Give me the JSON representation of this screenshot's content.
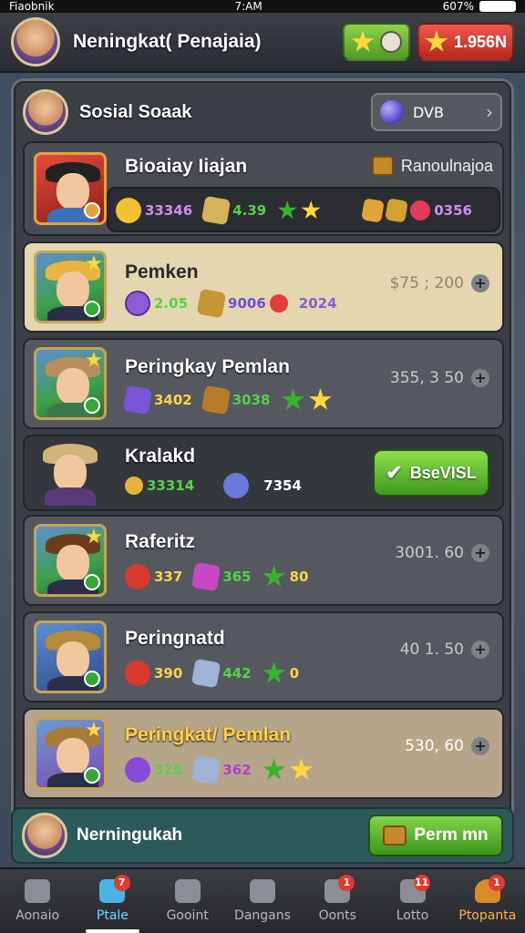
{
  "status": {
    "carrier": "Fiaobnik",
    "time": "7:AM",
    "battery": "607%"
  },
  "header": {
    "title": "Neningkat( Penajaia)",
    "gold_value": "1.956N"
  },
  "panel": {
    "title": "Sosial Soaak",
    "server_value": "DVB"
  },
  "featured": {
    "name": "Bioaiay Iiajan",
    "rank_label": "Ranoulnajoa",
    "res1": "33346",
    "res2": "4.39",
    "res3": "0356"
  },
  "rows": [
    {
      "name": "Pemken",
      "power": "$75 ; 200",
      "r1": "2.05",
      "r2": "9006",
      "r3": "2024"
    },
    {
      "name": "Peringkay Pemlan",
      "power": "355, 3 50",
      "r1": "3402",
      "r2": "3038",
      "r3": ""
    },
    {
      "name": "Kralakd",
      "power": "",
      "r1": "33314",
      "r2": "7354",
      "r3": "",
      "button": "BseVISL"
    },
    {
      "name": "Raferitz",
      "power": "3001. 60",
      "r1": "337",
      "r2": "365",
      "r3": "80"
    },
    {
      "name": "Peringnatd",
      "power": "40 1. 50",
      "r1": "390",
      "r2": "442",
      "r3": "0"
    },
    {
      "name": "Peringkat/ Pemlan",
      "power": "530, 60",
      "r1": "320",
      "r2": "362",
      "r3": ""
    }
  ],
  "bottom": {
    "name": "Nerningukah",
    "button": "Perm mn"
  },
  "tabs": [
    {
      "label": "Aonaio",
      "badge": ""
    },
    {
      "label": "Ptale",
      "badge": "7"
    },
    {
      "label": "Gooint",
      "badge": ""
    },
    {
      "label": "Dangans",
      "badge": ""
    },
    {
      "label": "Oonts",
      "badge": "1"
    },
    {
      "label": "Lotto",
      "badge": "11"
    },
    {
      "label": "Ptopanta",
      "badge": "1"
    }
  ],
  "colors": {
    "accent_green": "#4e9a23",
    "accent_red": "#b8251d",
    "row_light": "#e4d6ae",
    "row_dark": "#55585e"
  }
}
